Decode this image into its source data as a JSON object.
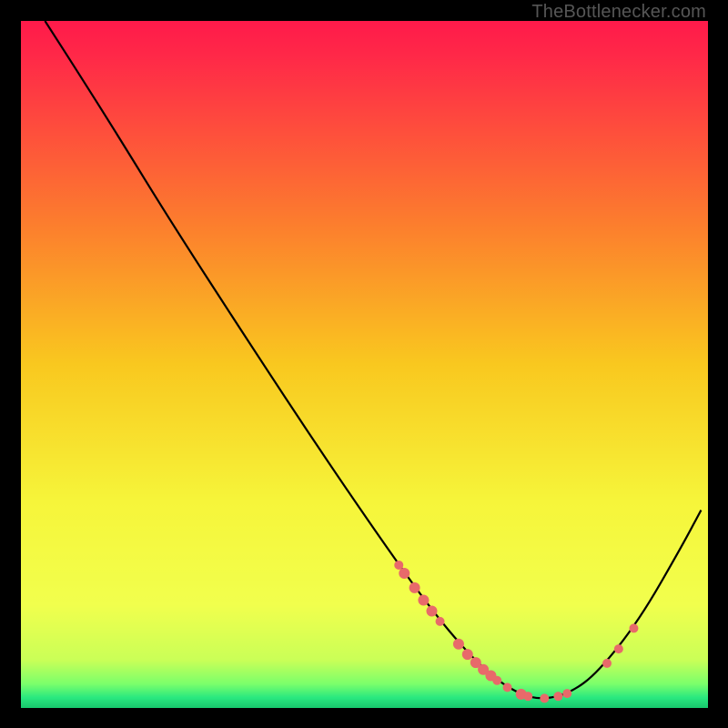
{
  "watermark": "TheBottlenecker.com",
  "chart_data": {
    "type": "line",
    "title": "",
    "xlabel": "",
    "ylabel": "",
    "xlim": [
      0,
      100
    ],
    "ylim": [
      0,
      100
    ],
    "gradient_stops": [
      {
        "offset": 0,
        "color": "#ff1a4a"
      },
      {
        "offset": 0.05,
        "color": "#ff2848"
      },
      {
        "offset": 0.3,
        "color": "#fc7f2d"
      },
      {
        "offset": 0.5,
        "color": "#f9c81f"
      },
      {
        "offset": 0.7,
        "color": "#f6f53a"
      },
      {
        "offset": 0.85,
        "color": "#f1ff4d"
      },
      {
        "offset": 0.93,
        "color": "#caff57"
      },
      {
        "offset": 0.965,
        "color": "#7bff6b"
      },
      {
        "offset": 0.985,
        "color": "#29e87f"
      },
      {
        "offset": 1.0,
        "color": "#18c76d"
      }
    ],
    "curve": [
      {
        "x": 3.5,
        "y": 100.0
      },
      {
        "x": 8.0,
        "y": 93.0
      },
      {
        "x": 14.0,
        "y": 83.5
      },
      {
        "x": 22.0,
        "y": 70.5
      },
      {
        "x": 33.0,
        "y": 53.5
      },
      {
        "x": 44.0,
        "y": 36.8
      },
      {
        "x": 55.0,
        "y": 20.8
      },
      {
        "x": 62.0,
        "y": 11.4
      },
      {
        "x": 68.0,
        "y": 5.0
      },
      {
        "x": 72.5,
        "y": 2.0
      },
      {
        "x": 76.0,
        "y": 1.2
      },
      {
        "x": 80.0,
        "y": 2.2
      },
      {
        "x": 84.0,
        "y": 5.2
      },
      {
        "x": 90.0,
        "y": 12.8
      },
      {
        "x": 96.0,
        "y": 23.2
      },
      {
        "x": 99.0,
        "y": 28.8
      }
    ],
    "markers": [
      {
        "x": 55.0,
        "y": 20.8,
        "r": 5
      },
      {
        "x": 55.8,
        "y": 19.6,
        "r": 6
      },
      {
        "x": 57.3,
        "y": 17.5,
        "r": 6
      },
      {
        "x": 58.6,
        "y": 15.7,
        "r": 6
      },
      {
        "x": 59.8,
        "y": 14.1,
        "r": 6
      },
      {
        "x": 61.0,
        "y": 12.6,
        "r": 5
      },
      {
        "x": 63.7,
        "y": 9.3,
        "r": 6
      },
      {
        "x": 65.0,
        "y": 7.8,
        "r": 6
      },
      {
        "x": 66.2,
        "y": 6.6,
        "r": 6
      },
      {
        "x": 67.3,
        "y": 5.6,
        "r": 6
      },
      {
        "x": 68.4,
        "y": 4.7,
        "r": 6
      },
      {
        "x": 69.3,
        "y": 4.0,
        "r": 5
      },
      {
        "x": 70.8,
        "y": 3.0,
        "r": 5
      },
      {
        "x": 72.8,
        "y": 2.0,
        "r": 6
      },
      {
        "x": 73.8,
        "y": 1.7,
        "r": 5
      },
      {
        "x": 76.2,
        "y": 1.4,
        "r": 5
      },
      {
        "x": 78.2,
        "y": 1.7,
        "r": 5
      },
      {
        "x": 79.5,
        "y": 2.1,
        "r": 5
      },
      {
        "x": 85.3,
        "y": 6.5,
        "r": 5
      },
      {
        "x": 87.0,
        "y": 8.6,
        "r": 5
      },
      {
        "x": 89.2,
        "y": 11.6,
        "r": 5
      }
    ],
    "marker_color": "#e86a6a"
  }
}
